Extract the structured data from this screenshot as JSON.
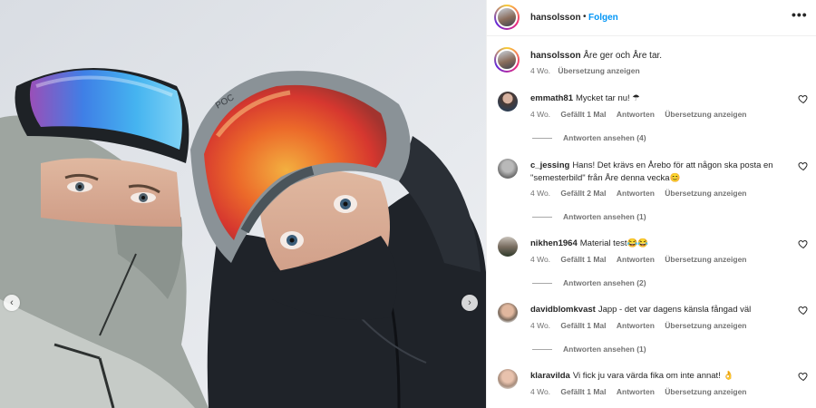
{
  "header": {
    "username": "hansolsson",
    "dot": "•",
    "follow_label": "Folgen",
    "more_label": "•••"
  },
  "media": {
    "prev_label": "‹",
    "next_label": "›",
    "goggle_brand": "POC"
  },
  "caption": {
    "username": "hansolsson",
    "text": "Åre ger och Åre tar.",
    "age": "4 Wo.",
    "translate": "Übersetzung anzeigen"
  },
  "comments": [
    {
      "username": "emmath81",
      "text": "Mycket tar nu! ☂",
      "age": "4 Wo.",
      "likes": "Gefällt 1 Mal",
      "reply": "Antworten",
      "translate": "Übersetzung anzeigen",
      "replies": "Antworten ansehen (4)"
    },
    {
      "username": "c_jessing",
      "text": "Hans! Det krävs en Årebo för att någon ska posta en \"semesterbild\" från Åre denna vecka😊",
      "age": "4 Wo.",
      "likes": "Gefällt 2 Mal",
      "reply": "Antworten",
      "translate": "Übersetzung anzeigen",
      "replies": "Antworten ansehen (1)"
    },
    {
      "username": "nikhen1964",
      "text": "Material test😂😂",
      "age": "4 Wo.",
      "likes": "Gefällt 1 Mal",
      "reply": "Antworten",
      "translate": "Übersetzung anzeigen",
      "replies": "Antworten ansehen (2)"
    },
    {
      "username": "davidblomkvast",
      "text": "Japp - det var dagens känsla fångad väl",
      "age": "4 Wo.",
      "likes": "Gefällt 1 Mal",
      "reply": "Antworten",
      "translate": "Übersetzung anzeigen",
      "replies": "Antworten ansehen (1)"
    },
    {
      "username": "klaravilda",
      "text": "Vi fick ju vara värda fika om inte annat! 👌",
      "age": "4 Wo.",
      "likes": "Gefällt 1 Mal",
      "reply": "Antworten",
      "translate": "Übersetzung anzeigen"
    }
  ]
}
